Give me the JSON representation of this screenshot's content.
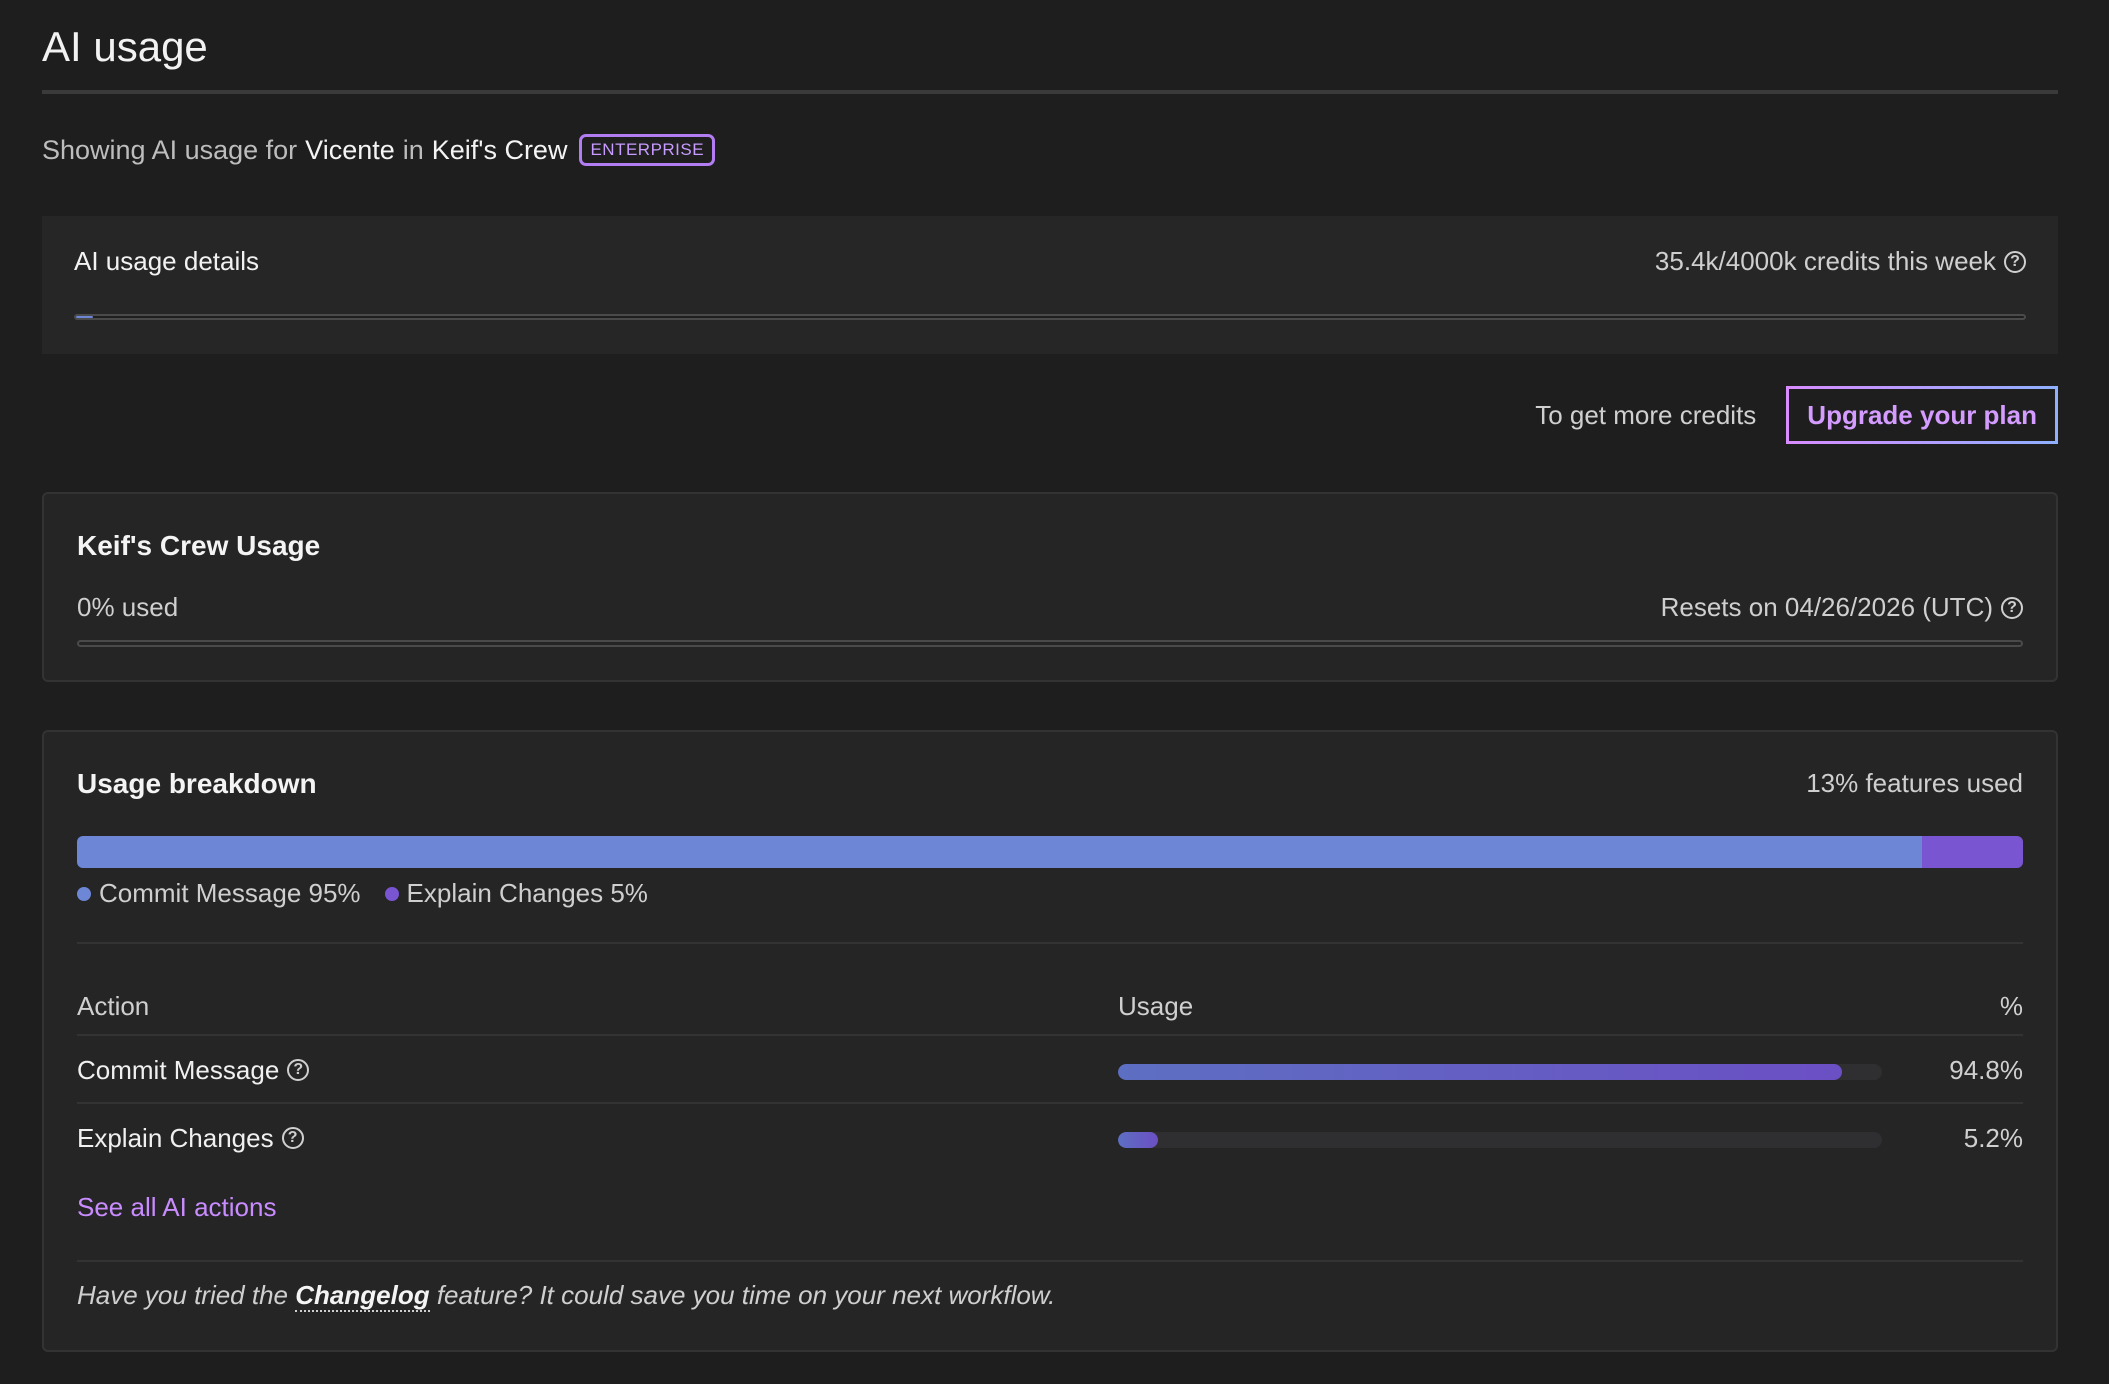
{
  "page": {
    "title": "AI usage"
  },
  "subtitle": {
    "prefix": "Showing AI usage for",
    "user": "Vicente",
    "in": "in",
    "org": "Keif's Crew",
    "badge": "ENTERPRISE"
  },
  "details": {
    "label": "AI usage details",
    "credits_text": "35.4k/4000k credits this week",
    "progress_fraction": 0.00885,
    "help_icon": "question-circle-icon"
  },
  "upgrade": {
    "hint": "To get more credits",
    "button_label": "Upgrade your plan"
  },
  "crew_usage": {
    "title": "Keif's Crew Usage",
    "used_text": "0% used",
    "resets_text": "Resets on 04/26/2026 (UTC)",
    "progress_fraction": 0
  },
  "breakdown": {
    "title": "Usage breakdown",
    "features_text": "13% features used",
    "segments": [
      {
        "label": "Commit Message 95%",
        "fraction": 0.948,
        "color": "#6d86d6"
      },
      {
        "label": "Explain Changes 5%",
        "fraction": 0.052,
        "color": "#7a55d2"
      }
    ],
    "columns": {
      "action": "Action",
      "usage": "Usage",
      "pct": "%"
    },
    "rows": [
      {
        "action": "Commit Message",
        "fraction": 0.948,
        "pct": "94.8%"
      },
      {
        "action": "Explain Changes",
        "fraction": 0.052,
        "pct": "5.2%"
      }
    ],
    "see_all": "See all AI actions",
    "tip": {
      "before": "Have you tried the",
      "link": "Changelog",
      "after": "feature? It could save you time on your next workflow."
    }
  },
  "colors": {
    "accent_purple": "#b27cf2",
    "bar_blue": "#6d86d6",
    "bar_violet": "#7a55d2"
  }
}
